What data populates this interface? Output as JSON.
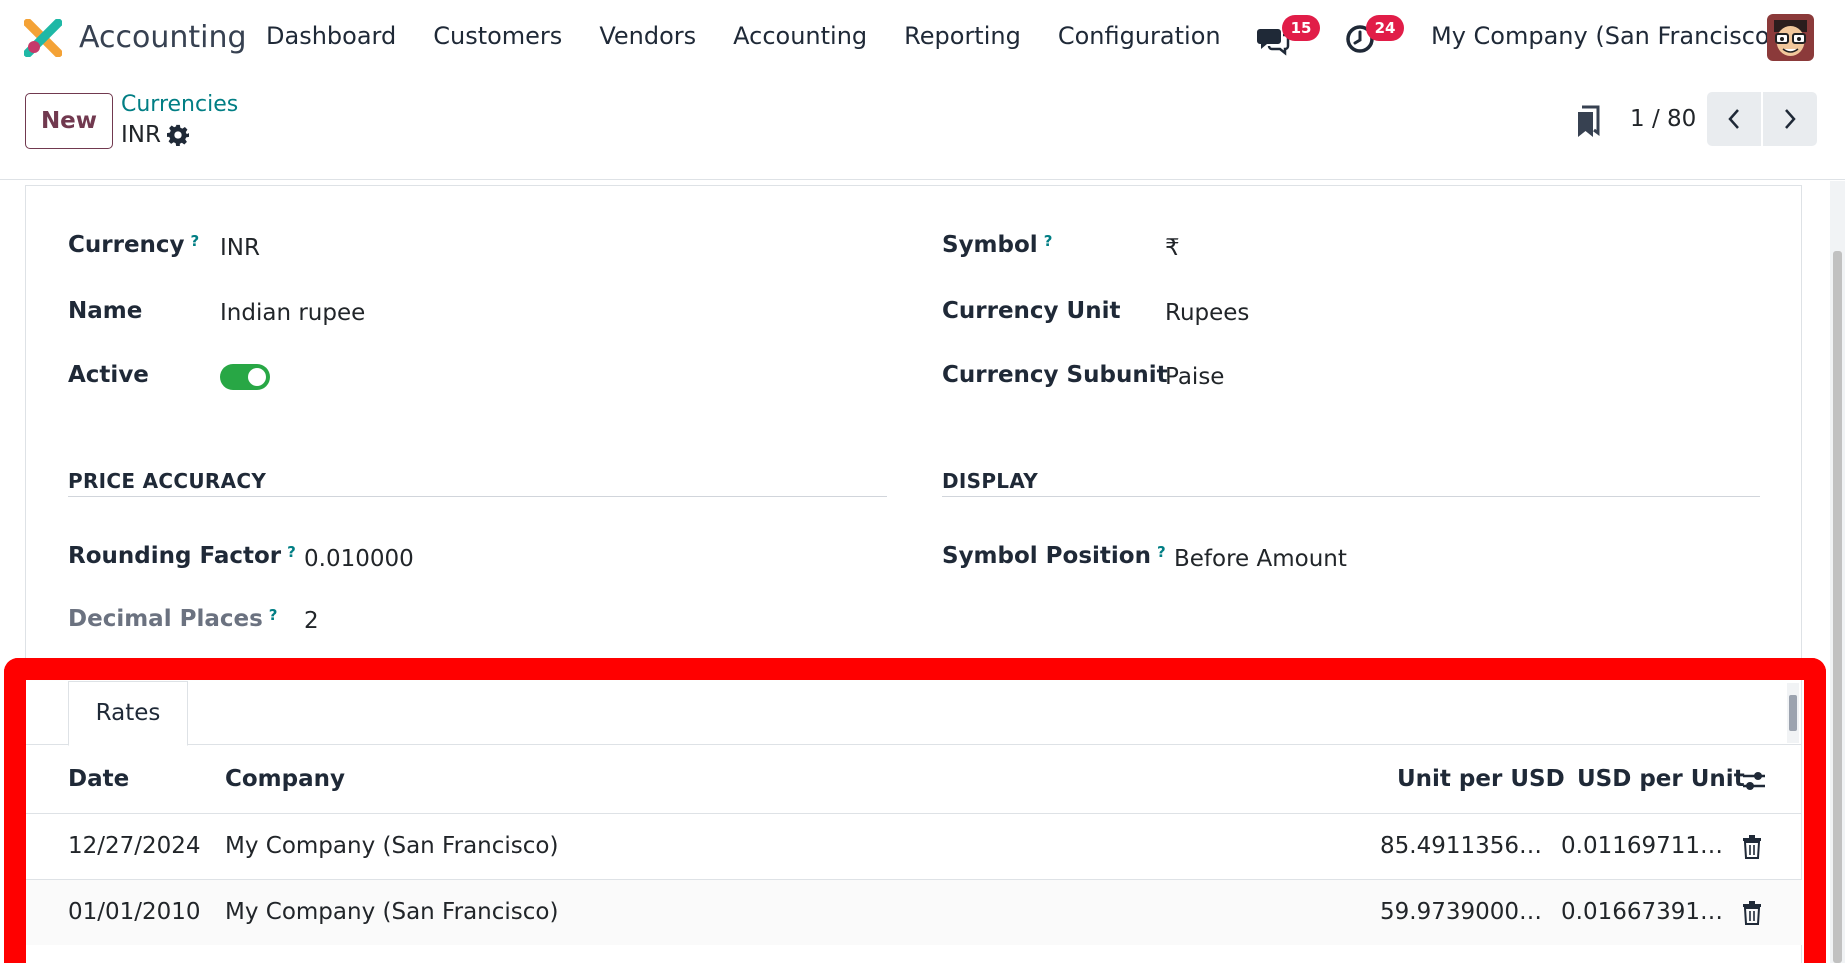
{
  "navbar": {
    "app_name": "Accounting",
    "menu": [
      "Dashboard",
      "Customers",
      "Vendors",
      "Accounting",
      "Reporting",
      "Configuration"
    ],
    "messages_badge": "15",
    "activities_badge": "24",
    "company": "My Company (San Francisco)"
  },
  "control_panel": {
    "new_label": "New",
    "breadcrumb_parent": "Currencies",
    "breadcrumb_current": "INR",
    "pager": "1 / 80"
  },
  "form": {
    "currency_label": "Currency",
    "currency_value": "INR",
    "name_label": "Name",
    "name_value": "Indian rupee",
    "active_label": "Active",
    "active_value": true,
    "symbol_label": "Symbol",
    "symbol_value": "₹",
    "unit_label": "Currency Unit",
    "unit_value": "Rupees",
    "subunit_label": "Currency Subunit",
    "subunit_value": "Paise",
    "help_mark": "?",
    "price_accuracy_title": "PRICE ACCURACY",
    "display_title": "DISPLAY",
    "rounding_label": "Rounding Factor",
    "rounding_value": "0.010000",
    "decimal_label": "Decimal Places",
    "decimal_value": "2",
    "symbol_position_label": "Symbol Position",
    "symbol_position_value": "Before Amount"
  },
  "rates": {
    "tab_label": "Rates",
    "columns": [
      "Date",
      "Company",
      "Unit per USD",
      "USD per Unit"
    ],
    "rows": [
      {
        "date": "12/27/2024",
        "company": "My Company (San Francisco)",
        "unit_per_usd": "85.4911356…",
        "usd_per_unit": "0.01169711…"
      },
      {
        "date": "01/01/2010",
        "company": "My Company (San Francisco)",
        "unit_per_usd": "59.9739000…",
        "usd_per_unit": "0.01667391…"
      }
    ]
  },
  "colors": {
    "brand": "#71394f",
    "link": "#017e84",
    "toggle_on": "#28a745",
    "badge": "#e11d48",
    "highlight": "#ff0000"
  }
}
